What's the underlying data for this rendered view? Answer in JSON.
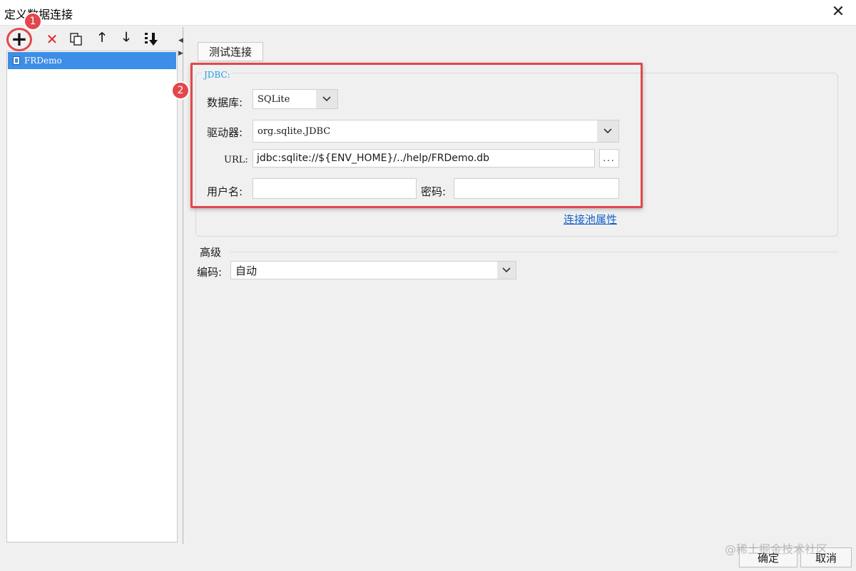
{
  "window": {
    "title": "定义数据连接",
    "close_glyph": "✕"
  },
  "toolbar": {
    "add_glyph": "+",
    "delete_glyph": "✕",
    "move_up_glyph": "🡑",
    "move_down_glyph": "🡓"
  },
  "tree": {
    "items": [
      {
        "label": "FRDemo"
      }
    ]
  },
  "buttons": {
    "test_connection": "测试连接",
    "ok": "确定",
    "cancel": "取消"
  },
  "jdbc": {
    "section_label": "JDBC:",
    "database_label": "数据库:",
    "database_value": "SQLite",
    "driver_label": "驱动器:",
    "driver_value": "org.sqlite.JDBC",
    "url_label": "URL:",
    "url_value": "jdbc:sqlite://${ENV_HOME}/../help/FRDemo.db",
    "url_browse": "...",
    "username_label": "用户名:",
    "username_value": "",
    "password_label": "密码:",
    "password_value": "",
    "pool_link": "连接池属性"
  },
  "advanced": {
    "section_label": "高级",
    "encoding_label": "编码:",
    "encoding_value": "自动"
  },
  "annotations": {
    "marker_1": "1",
    "marker_2": "2"
  },
  "watermark": "@稀土掘金技术社区",
  "colors": {
    "selection": "#3d8ee6",
    "annotation_red": "#e2474b",
    "link": "#1660c8",
    "jdbc_label": "#1a9ee4"
  }
}
